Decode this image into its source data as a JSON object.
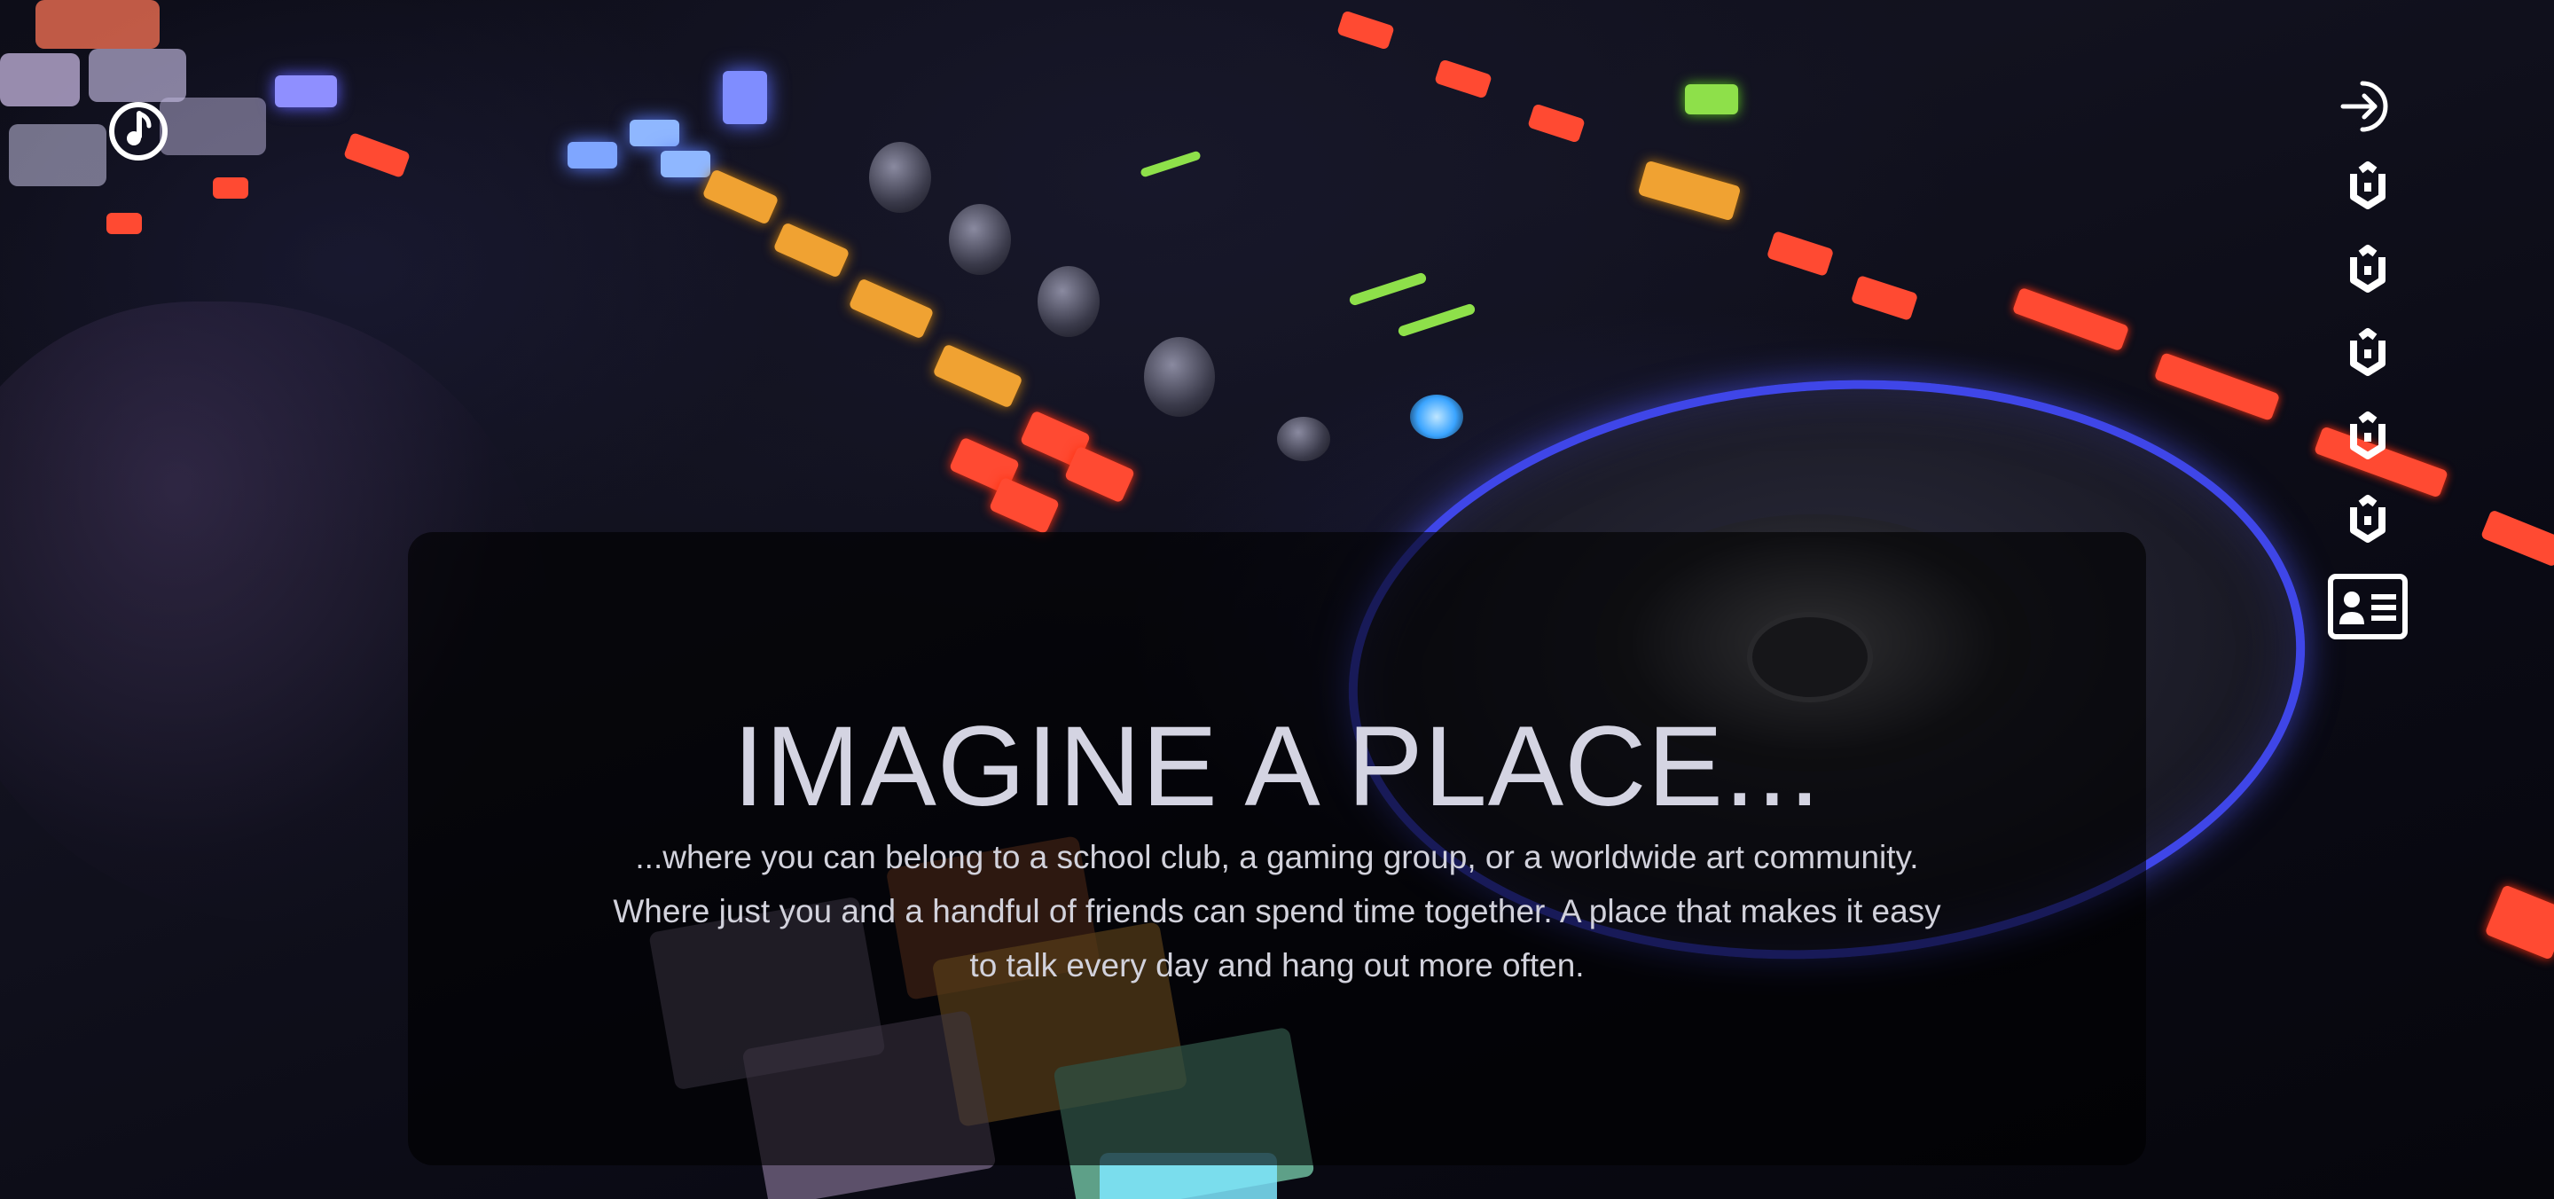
{
  "brand": {
    "logo_icon": "music-note-circle-icon"
  },
  "hero": {
    "title": "IMAGINE A PLACE...",
    "line1": "...where you can belong to a school club, a gaming group, or a worldwide art community.",
    "line2": "Where just you and a handful of friends can spend time together. A place that makes it easy",
    "line3": "to talk every day and hang out more often."
  },
  "right_nav": {
    "items": [
      {
        "icon": "sign-in-icon"
      },
      {
        "icon": "hexagon-cube-icon"
      },
      {
        "icon": "hexagon-cube-icon"
      },
      {
        "icon": "hexagon-cube-icon"
      },
      {
        "icon": "hexagon-cube-icon"
      },
      {
        "icon": "hexagon-cube-icon"
      },
      {
        "icon": "id-card-icon"
      }
    ]
  },
  "colors": {
    "icon": "#ffffff",
    "title": "#d4d4e2",
    "body_text": "#d2d2dc",
    "panel": "rgba(0,0,0,0.62)",
    "platter_ring": "#3f46e8"
  }
}
